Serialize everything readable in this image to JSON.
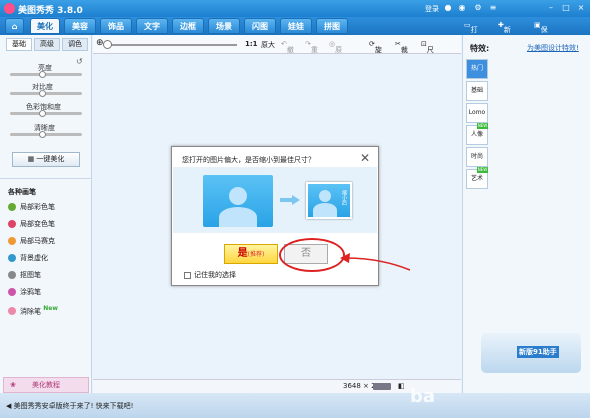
{
  "app": {
    "title": "美图秀秀 3.8.0",
    "login": "登录"
  },
  "tabs": [
    {
      "label": "美化",
      "active": true
    },
    {
      "label": "美容"
    },
    {
      "label": "饰品"
    },
    {
      "label": "文字"
    },
    {
      "label": "边框"
    },
    {
      "label": "场景"
    },
    {
      "label": "闪图"
    },
    {
      "label": "娃娃"
    },
    {
      "label": "拼图"
    }
  ],
  "header_actions": {
    "open": "打开",
    "new": "新建",
    "save_share": "保存与分享"
  },
  "left_panel": {
    "subtabs": [
      "基础",
      "高级",
      "调色"
    ],
    "sliders": [
      "亮度",
      "对比度",
      "色彩饱和度",
      "清晰度"
    ],
    "one_key": "一键美化",
    "brushes_title": "各种画笔",
    "brushes": [
      "局部彩色笔",
      "局部变色笔",
      "局部马赛克",
      "背景虚化",
      "抠图笔",
      "涂鸦笔",
      "消除笔"
    ],
    "new_tag": "New",
    "tutorial": "美化教程"
  },
  "canvas_toolbar": {
    "ratio": "1:1",
    "original": "原大",
    "undo": "撤销",
    "redo": "重做",
    "reset": "原图",
    "rotate": "旋转",
    "crop": "裁剪",
    "resize": "尺寸"
  },
  "status": {
    "size": "3648 × 2736"
  },
  "dialog": {
    "message": "您打开的图片偏大，是否缩小到最佳尺寸？",
    "thumb_text": "缩小后",
    "yes": "是",
    "yes_note": "(推荐)",
    "no": "否",
    "remember": "记住我的选择"
  },
  "right_panel": {
    "title": "特效:",
    "link": "为美图设计特效!",
    "effects": [
      {
        "label": "热门",
        "active": true
      },
      {
        "label": "基础"
      },
      {
        "label": "Lomo"
      },
      {
        "label": "人像",
        "hot": true
      },
      {
        "label": "时尚"
      },
      {
        "label": "艺术",
        "hot": true
      }
    ],
    "hot_tag": "NEW",
    "promo": "新版91助手"
  },
  "bottom": {
    "tip": "美图秀秀安卓版终于来了! 快来下载吧!",
    "watermark": "ba"
  },
  "colors": {
    "accent": "#1d7fcf",
    "annotation": "#dd2222",
    "yes_button": "#ffd640"
  }
}
